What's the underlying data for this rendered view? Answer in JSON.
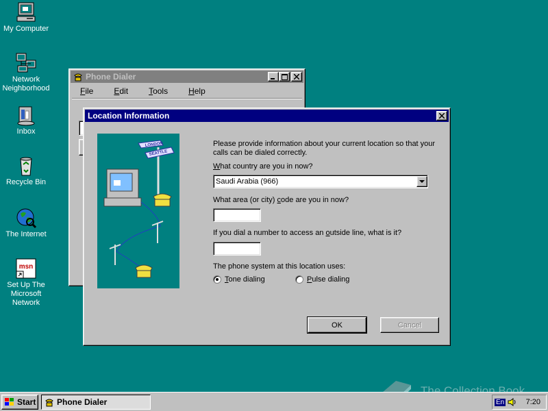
{
  "desktop": {
    "icons": [
      {
        "label": "My Computer"
      },
      {
        "label": "Network Neighborhood"
      },
      {
        "label": "Inbox"
      },
      {
        "label": "Recycle Bin"
      },
      {
        "label": "The Internet"
      },
      {
        "label": "Set Up The Microsoft Network"
      }
    ]
  },
  "dialer": {
    "title": "Phone Dialer",
    "menu": [
      {
        "pre": "",
        "key": "F",
        "post": "ile"
      },
      {
        "pre": "",
        "key": "E",
        "post": "dit"
      },
      {
        "pre": "",
        "key": "T",
        "post": "ools"
      },
      {
        "pre": "",
        "key": "H",
        "post": "elp"
      }
    ]
  },
  "location_dialog": {
    "title": "Location Information",
    "intro": "Please provide information about your current location so that your calls can be dialed correctly.",
    "country_question": {
      "pre": "",
      "key": "W",
      "post": "hat country are you in now?"
    },
    "country_value": "Saudi Arabia (966)",
    "area_question": {
      "pre": "What area (or city) ",
      "key": "c",
      "post": "ode are you in now?"
    },
    "area_value": "",
    "outside_question": {
      "pre": "If you dial a number to access an ",
      "key": "o",
      "post": "utside line, what is it?"
    },
    "outside_value": "",
    "phone_system_label": "The phone system at this location uses:",
    "tone": {
      "key": "T",
      "post": "one dialing",
      "selected": true
    },
    "pulse": {
      "key": "P",
      "post": "ulse dialing",
      "selected": false
    },
    "ok_label": "OK",
    "cancel_label": "Cancel",
    "sign_labels": [
      "LONDON",
      "SEATTLE"
    ]
  },
  "taskbar": {
    "start_label": "Start",
    "task_label": "Phone Dialer",
    "language": "En",
    "clock": "7:20"
  },
  "watermark": "The Collection Book",
  "colors": {
    "desktop": "#008080",
    "active_title": "#000080",
    "inactive_title": "#808080",
    "face": "#c0c0c0"
  }
}
